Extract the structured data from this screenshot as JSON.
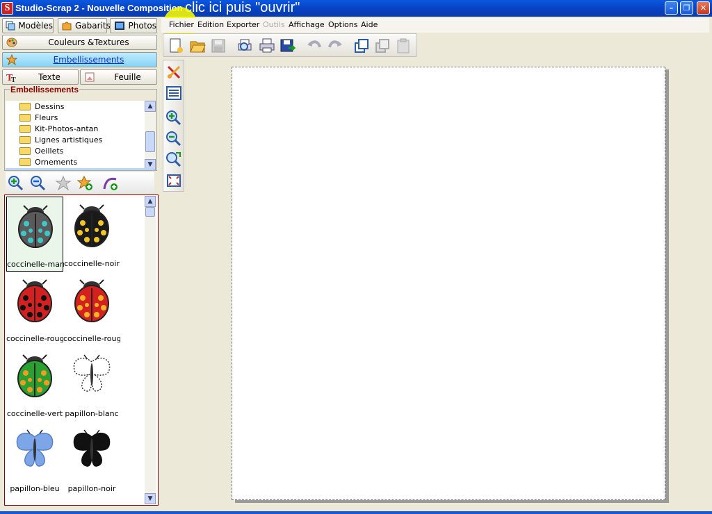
{
  "window": {
    "title": "Studio-Scrap 2 - Nouvelle Composition",
    "hint": "clic ici puis \"ouvrir\"",
    "app_icon_letter": "S"
  },
  "left_panel": {
    "tabs": {
      "modeles": "Modèles",
      "gabarits": "Gabarits",
      "photos": "Photos",
      "couleurs": "Couleurs &Textures",
      "embellissements": "Embellissements",
      "texte": "Texte",
      "feuille": "Feuille"
    },
    "group_title": "Embellissements",
    "folders": [
      "Dessins",
      "Fleurs",
      "Kit-Photos-antan",
      "Lignes artistiques",
      "Oeillets",
      "Ornements"
    ],
    "gallery": [
      {
        "caption": "coccinelle-marr",
        "icon": "ladybug-brown",
        "body": "#5a5a5a",
        "spot": "#3cc8c8"
      },
      {
        "caption": "coccinelle-noir",
        "icon": "ladybug-black",
        "body": "#1a1a1a",
        "spot": "#f2c623"
      },
      {
        "caption": "coccinelle-roug",
        "icon": "ladybug-red",
        "body": "#d42020",
        "spot": "#111111"
      },
      {
        "caption": "coccinelle-roug",
        "icon": "ladybug-red-yellow",
        "body": "#d42020",
        "spot": "#f2b623"
      },
      {
        "caption": "coccinelle-vert",
        "icon": "ladybug-green",
        "body": "#2aa032",
        "spot": "#f29a23"
      },
      {
        "caption": "papillon-blanc",
        "icon": "butterfly-white",
        "body": "#ffffff",
        "spot": "#444444"
      },
      {
        "caption": "papillon-bleu",
        "icon": "butterfly-blue",
        "body": "#7ca6e8",
        "spot": "#5a80c8"
      },
      {
        "caption": "papillon-noir",
        "icon": "butterfly-black",
        "body": "#111111",
        "spot": "#111111"
      }
    ]
  },
  "menu": {
    "fichier": "Fichier",
    "edition": "Edition",
    "exporter": "Exporter",
    "outils": "Outils",
    "affichage": "Affichage",
    "options": "Options",
    "aide": "Aide"
  },
  "colors": {
    "titlebar": "#0841c2",
    "accent_tab": "#86d3f5",
    "group_title": "#8b0000",
    "highlight": "#ffff00"
  }
}
